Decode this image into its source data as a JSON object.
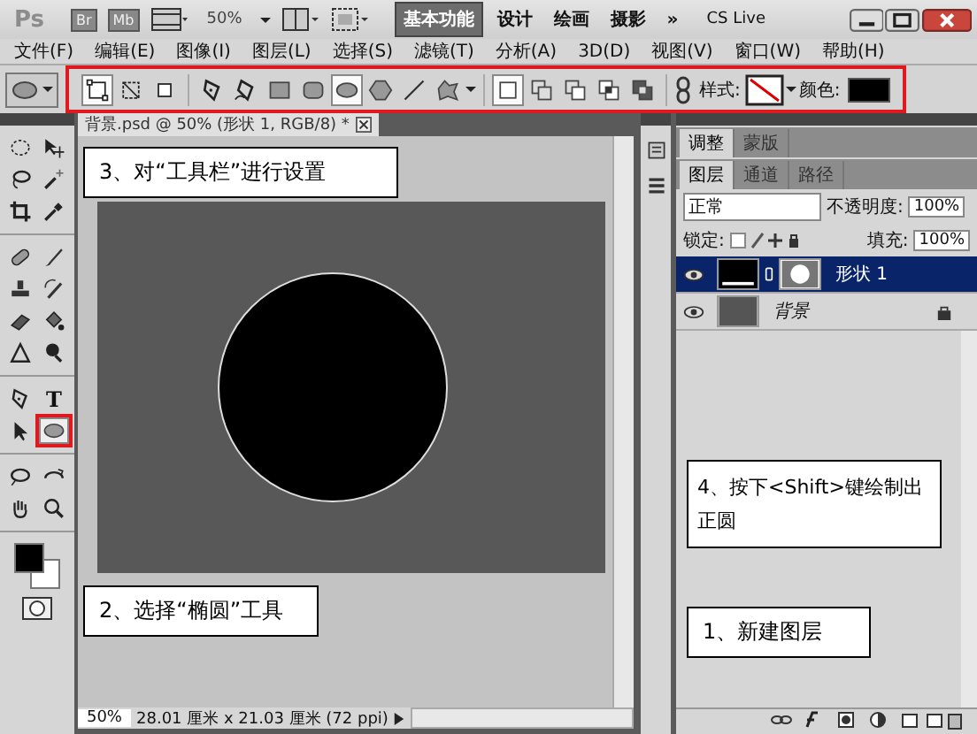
{
  "app_bar": {
    "logo": "Ps",
    "bridge": "Br",
    "mini_bridge": "Mb",
    "zoom": "50%",
    "workspaces": [
      {
        "label": "基本功能",
        "selected": true
      },
      {
        "label": "设计",
        "selected": false
      },
      {
        "label": "绘画",
        "selected": false
      },
      {
        "label": "摄影",
        "selected": false
      }
    ],
    "more": "»",
    "cs_live": "CS Live"
  },
  "menu": [
    "文件(F)",
    "编辑(E)",
    "图像(I)",
    "图层(L)",
    "选择(S)",
    "滤镜(T)",
    "分析(A)",
    "3D(D)",
    "视图(V)",
    "窗口(W)",
    "帮助(H)"
  ],
  "options_bar": {
    "highlighted": true,
    "path_modes": [
      {
        "kind": "shape-layers",
        "selected": true
      },
      {
        "kind": "paths",
        "selected": false
      },
      {
        "kind": "fill-pixels",
        "selected": false
      }
    ],
    "shape_tools": [
      {
        "kind": "pen",
        "selected": false
      },
      {
        "kind": "freeform-pen",
        "selected": false
      },
      {
        "kind": "rectangle",
        "selected": false
      },
      {
        "kind": "rounded-rectangle",
        "selected": false
      },
      {
        "kind": "ellipse",
        "selected": true
      },
      {
        "kind": "polygon",
        "selected": false
      },
      {
        "kind": "line",
        "selected": false
      },
      {
        "kind": "custom-shape",
        "selected": false
      }
    ],
    "combine_modes": [
      {
        "kind": "new",
        "selected": true
      },
      {
        "kind": "add",
        "selected": false
      },
      {
        "kind": "subtract",
        "selected": false
      },
      {
        "kind": "intersect",
        "selected": false
      },
      {
        "kind": "exclude",
        "selected": false
      }
    ],
    "style_label": "样式:",
    "color_label": "颜色:"
  },
  "toolbox": {
    "groups": [
      [
        {
          "kind": "marquee",
          "selected": false,
          "highlighted": false
        },
        {
          "kind": "move",
          "selected": false,
          "highlighted": false
        },
        {
          "kind": "lasso",
          "selected": false,
          "highlighted": false
        },
        {
          "kind": "wand",
          "selected": false,
          "highlighted": false
        },
        {
          "kind": "crop",
          "selected": false,
          "highlighted": false
        },
        {
          "kind": "eyedropper",
          "selected": false,
          "highlighted": false
        }
      ],
      [
        {
          "kind": "heal",
          "selected": false,
          "highlighted": false
        },
        {
          "kind": "brush",
          "selected": false,
          "highlighted": false
        },
        {
          "kind": "stamp",
          "selected": false,
          "highlighted": false
        },
        {
          "kind": "history-brush",
          "selected": false,
          "highlighted": false
        },
        {
          "kind": "eraser",
          "selected": false,
          "highlighted": false
        },
        {
          "kind": "bucket",
          "selected": false,
          "highlighted": false
        },
        {
          "kind": "blur",
          "selected": false,
          "highlighted": false
        },
        {
          "kind": "dodge",
          "selected": false,
          "highlighted": false
        }
      ],
      [
        {
          "kind": "pen",
          "selected": false,
          "highlighted": false
        },
        {
          "kind": "type",
          "glyph": "T",
          "selected": false,
          "highlighted": false
        },
        {
          "kind": "path-select",
          "selected": false,
          "highlighted": false
        },
        {
          "kind": "ellipse",
          "selected": true,
          "highlighted": true
        }
      ],
      [
        {
          "kind": "rotate-3d",
          "selected": false,
          "highlighted": false
        },
        {
          "kind": "orbit-3d",
          "selected": false,
          "highlighted": false
        },
        {
          "kind": "hand",
          "selected": false,
          "highlighted": false
        },
        {
          "kind": "zoom",
          "selected": false,
          "highlighted": false
        }
      ]
    ]
  },
  "document": {
    "tab": "背景.psd @ 50% (形状 1, RGB/8) *",
    "top_note": "3、对“工具栏”进行设置",
    "bottom_note": "2、选择“椭圆”工具",
    "status_zoom": "50%",
    "status_info": "28.01 厘米 x 21.03 厘米 (72 ppi)"
  },
  "panels": {
    "top_tabs": [
      {
        "label": "调整",
        "selected": true
      },
      {
        "label": "蒙版",
        "selected": false
      }
    ],
    "tabs": [
      {
        "label": "图层",
        "selected": true
      },
      {
        "label": "通道",
        "selected": false
      },
      {
        "label": "路径",
        "selected": false
      }
    ],
    "blend_mode": "正常",
    "opacity_label": "不透明度:",
    "opacity": "100%",
    "lock_label": "锁定:",
    "fill_label": "填充:",
    "fill": "100%",
    "layers": [
      {
        "name": "形状 1",
        "kind": "shape",
        "selected": true,
        "visible": true,
        "locked": false
      },
      {
        "name": "背景",
        "kind": "background",
        "selected": false,
        "visible": true,
        "locked": true
      }
    ],
    "note": "4、按下<Shift>键绘制出正圆",
    "bottom_note": "1、新建图层"
  }
}
